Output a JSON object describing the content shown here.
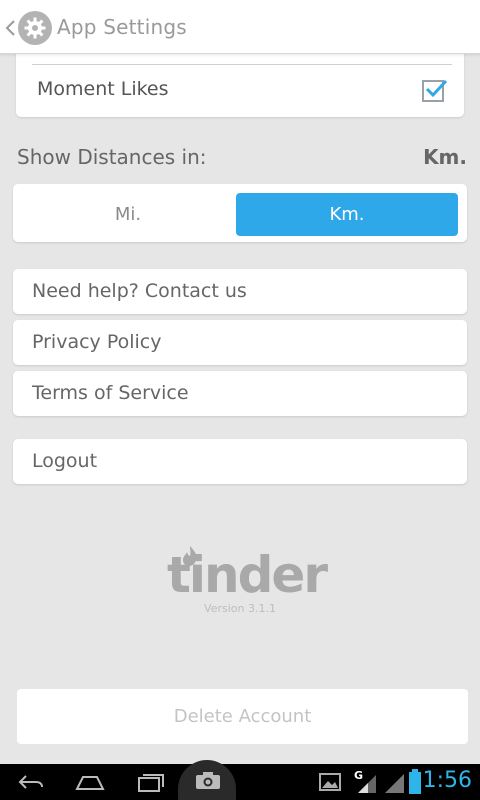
{
  "header": {
    "title": "App Settings"
  },
  "notifications": {
    "moment_likes_label": "Moment Likes",
    "moment_likes_checked": true
  },
  "distances": {
    "label": "Show Distances in:",
    "current": "Km.",
    "options": [
      "Mi.",
      "Km."
    ],
    "selected": "Km."
  },
  "links": {
    "help": "Need help? Contact us",
    "privacy": "Privacy Policy",
    "terms": "Terms of Service"
  },
  "logout": "Logout",
  "brand": {
    "version": "Version 3.1.1"
  },
  "delete_account": "Delete Account",
  "status_bar": {
    "time": "1:56",
    "network": "G"
  },
  "colors": {
    "accent": "#2fa8e9",
    "background": "#e6e6e6"
  }
}
